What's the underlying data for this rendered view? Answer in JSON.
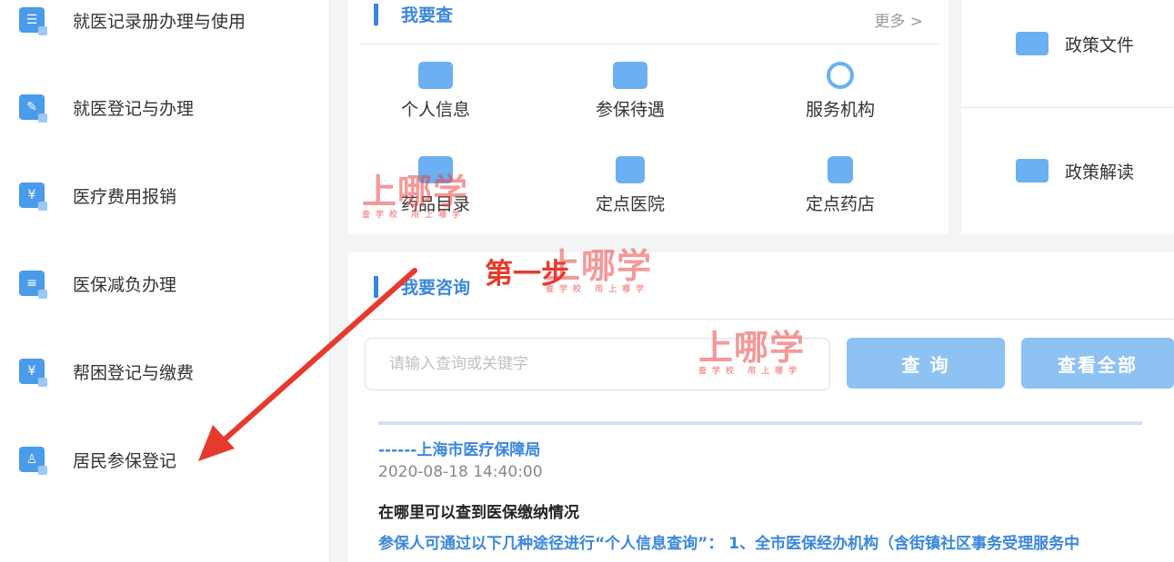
{
  "sidebar": {
    "items": [
      {
        "label": "就医记录册办理与使用",
        "icon": "record-book-icon"
      },
      {
        "label": "就医登记与办理",
        "icon": "edit-form-icon"
      },
      {
        "label": "医疗费用报销",
        "icon": "calendar-yuan-icon"
      },
      {
        "label": "医保减负办理",
        "icon": "checked-document-icon"
      },
      {
        "label": "帮困登记与缴费",
        "icon": "yuan-document-icon"
      },
      {
        "label": "居民参保登记",
        "icon": "person-card-icon"
      }
    ]
  },
  "query_section": {
    "title": "我要查",
    "more": "更多 >",
    "items": [
      {
        "label": "个人信息",
        "icon": "id-card-icon"
      },
      {
        "label": "参保待遇",
        "icon": "list-card-icon"
      },
      {
        "label": "服务机构",
        "icon": "headset-icon"
      },
      {
        "label": "药品目录",
        "icon": "pills-icon"
      },
      {
        "label": "定点医院",
        "icon": "hospital-building-icon"
      },
      {
        "label": "定点药店",
        "icon": "medicine-box-icon"
      }
    ]
  },
  "policy": {
    "items": [
      {
        "label": "政策文件",
        "icon": "folder-icon"
      },
      {
        "label": "政策解读",
        "icon": "document-icon"
      }
    ]
  },
  "consult_section": {
    "title": "我要咨询",
    "search_placeholder": "请输入查询或关键字",
    "query_button": "查 询",
    "view_all_button": "查看全部",
    "results": [
      {
        "link": "------上海市医疗保障局",
        "date": "2020-08-18 14:40:00"
      },
      {
        "title": "在哪里可以查到医保缴纳情况",
        "link": "参保人可通过以下几种途径进行“个人信息查询”： 1、全市医保经办机构（含街镇社区事务受理服务中"
      }
    ]
  },
  "annotation": {
    "step_text": "第一步"
  },
  "watermark": {
    "main": "上哪学",
    "sub": "查学校 用上哪学"
  },
  "colors": {
    "accent": "#3a86dd",
    "button": "#8ec2f3",
    "arrow": "#e63a2e"
  }
}
